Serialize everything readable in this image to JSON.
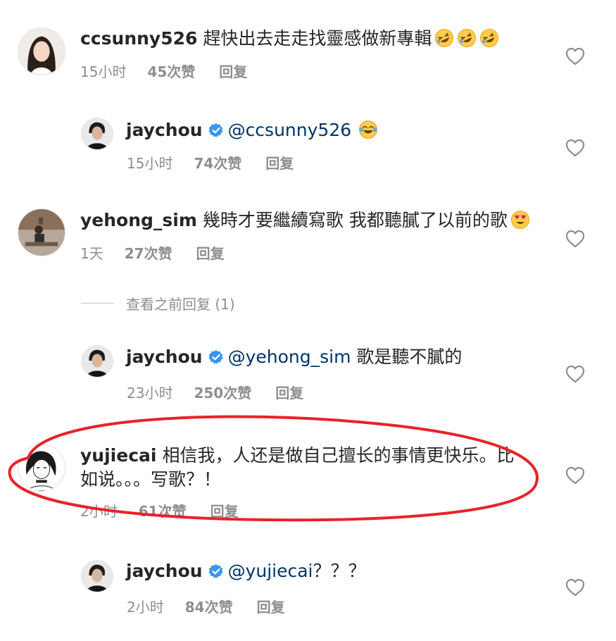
{
  "accent_color": "#3897f0",
  "highlight_color": "#e8232a",
  "view_previous": "查看之前回复 (1)",
  "comments": [
    {
      "username": "ccsunny526",
      "text": "趕快出去走走找靈感做新專輯",
      "emoji": [
        "rofl-emoji",
        "rofl-emoji",
        "rofl-emoji"
      ],
      "time": "15小时",
      "likes": "45次赞",
      "reply": "回复"
    },
    {
      "username": "jaychou",
      "verified": true,
      "mention": "@ccsunny526",
      "text": "",
      "emoji": [
        "tears-of-joy-emoji"
      ],
      "time": "15小时",
      "likes": "74次赞",
      "reply": "回复"
    },
    {
      "username": "yehong_sim",
      "text": "幾時才要繼續寫歌 我都聽膩了以前的歌",
      "emoji": [
        "heart-eyes-emoji"
      ],
      "time": "1天",
      "likes": "27次赞",
      "reply": "回复"
    },
    {
      "username": "jaychou",
      "verified": true,
      "mention": "@yehong_sim",
      "text": "歌是聽不膩的",
      "time": "23小时",
      "likes": "250次赞",
      "reply": "回复"
    },
    {
      "username": "yujiecai",
      "text": "相信我，人还是做自己擅长的事情更快乐。比如说。。。写歌？！",
      "time": "2小时",
      "likes": "61次赞",
      "reply": "回复"
    },
    {
      "username": "jaychou",
      "verified": true,
      "mention": "@yujiecai",
      "text": "？？？",
      "time": "2小时",
      "likes": "84次赞",
      "reply": "回复"
    }
  ]
}
